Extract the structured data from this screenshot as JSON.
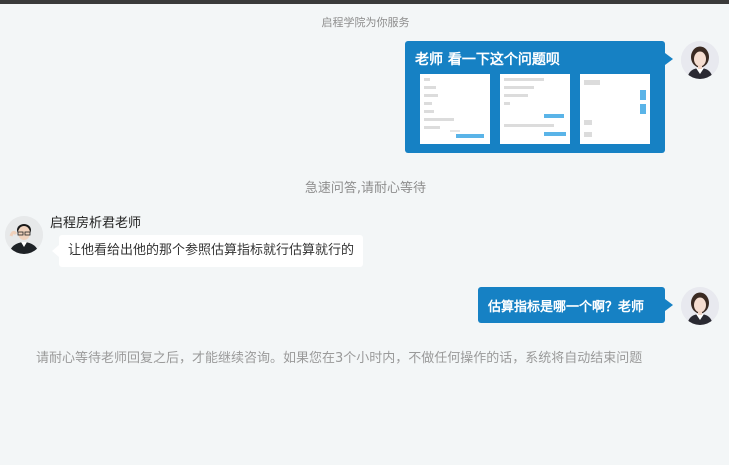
{
  "system": {
    "service_notice": "启程学院为你服务",
    "wait_notice": "急速问答,请耐心等待",
    "close_notice": "请耐心等待老师回复之后，才能继续咨询。如果您在3个小时内，不做任何操作的话，系统将自动结束问题"
  },
  "messages": {
    "student_q1": "老师 看一下这个问题呗",
    "teacher_name": "启程房析君老师",
    "teacher_answer": "让他看给出他的那个参照估算指标就行估算就行的",
    "student_q2": "估算指标是哪一个啊？老师"
  },
  "colors": {
    "bubble_out": "#1681c4",
    "background": "#f3f6f7"
  },
  "icons": {
    "student_avatar": "student-avatar-icon",
    "teacher_avatar": "teacher-avatar-icon"
  }
}
